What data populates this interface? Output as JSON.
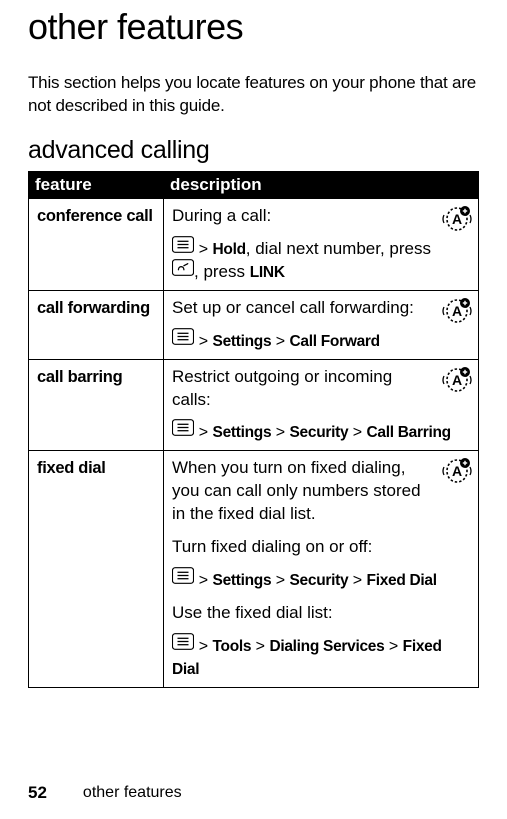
{
  "title": "other features",
  "intro": "This section helps you locate features on your phone that are not described in this guide.",
  "section_heading": "advanced calling",
  "table": {
    "header_feature": "feature",
    "header_description": "description",
    "rows": [
      {
        "feature": "conference call",
        "line1": "During a call:",
        "path_prefix": "Hold",
        "line2_mid": ", dial next number, press ",
        "line2_suffix": ", press ",
        "link_label": "LINK"
      },
      {
        "feature": "call forwarding",
        "line1": "Set up or cancel call forwarding:",
        "path_items": [
          "Settings",
          "Call Forward"
        ]
      },
      {
        "feature": "call barring",
        "line1": "Restrict outgoing or incoming calls:",
        "path_items": [
          "Settings",
          "Security",
          "Call Barring"
        ]
      },
      {
        "feature": "fixed dial",
        "line1": "When you turn on fixed dialing, you can call only numbers stored in the fixed dial list.",
        "line2": "Turn fixed dialing on or off:",
        "path1_items": [
          "Settings",
          "Security",
          "Fixed Dial"
        ],
        "line3": "Use the fixed dial list:",
        "path2_items": [
          "Tools",
          "Dialing Services",
          "Fixed Dial"
        ]
      }
    ]
  },
  "footer": {
    "page_number": "52",
    "text": "other features"
  }
}
